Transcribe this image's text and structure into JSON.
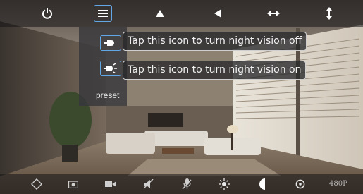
{
  "toolbar": {
    "icons": [
      "power-icon",
      "menu-icon",
      "tilt-up-icon",
      "pan-left-icon",
      "horizontal-patrol-icon",
      "vertical-patrol-icon"
    ]
  },
  "menu": {
    "items": [
      {
        "icon": "night-vision-off-icon",
        "tooltip": "Tap this icon to turn night vision off"
      },
      {
        "icon": "night-vision-on-icon",
        "tooltip": "Tap this icon to turn night vision on"
      }
    ],
    "preset_label": "preset"
  },
  "bottom_toolbar": {
    "icons": [
      "rotate-icon",
      "snapshot-icon",
      "record-icon",
      "mute-icon",
      "microphone-icon",
      "brightness-icon",
      "contrast-icon",
      "settings-icon"
    ],
    "resolution": "480P"
  },
  "colors": {
    "accent": "#63a8e6",
    "bar_background": "#141416",
    "text": "#f2f2f2"
  }
}
